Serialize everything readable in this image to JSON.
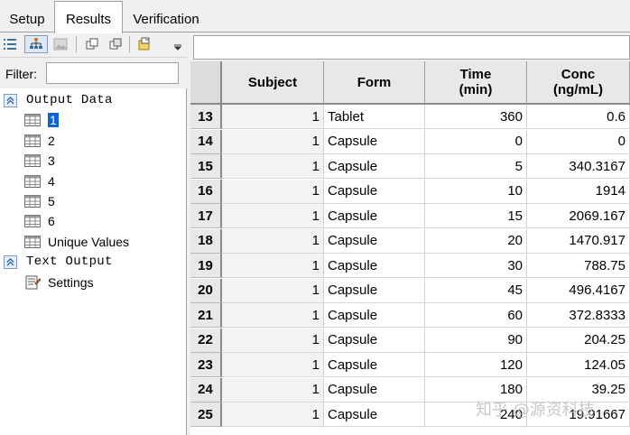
{
  "tabs": [
    {
      "label": "Setup",
      "active": false
    },
    {
      "label": "Results",
      "active": true
    },
    {
      "label": "Verification",
      "active": false
    }
  ],
  "toolbar": {
    "icons": [
      "list-view-icon",
      "tree-view-icon",
      "image-view-icon",
      "copy-icon",
      "copy-all-icon",
      "export-icon",
      "more-icon"
    ]
  },
  "filter": {
    "label": "Filter:",
    "value": ""
  },
  "tree": {
    "output_data": {
      "label": "Output Data",
      "items": [
        {
          "label": "1",
          "selected": true
        },
        {
          "label": "2",
          "selected": false
        },
        {
          "label": "3",
          "selected": false
        },
        {
          "label": "4",
          "selected": false
        },
        {
          "label": "5",
          "selected": false
        },
        {
          "label": "6",
          "selected": false
        },
        {
          "label": "Unique Values",
          "selected": false
        }
      ]
    },
    "text_output": {
      "label": "Text Output",
      "items": [
        {
          "label": "Settings"
        }
      ]
    }
  },
  "table": {
    "headers": [
      "Subject",
      "Form",
      "Time\n(min)",
      "Conc\n(ng/mL)"
    ],
    "rows": [
      {
        "n": "13",
        "subject": "1",
        "form": "Tablet",
        "time": "360",
        "conc": "0.6"
      },
      {
        "n": "14",
        "subject": "1",
        "form": "Capsule",
        "time": "0",
        "conc": "0"
      },
      {
        "n": "15",
        "subject": "1",
        "form": "Capsule",
        "time": "5",
        "conc": "340.3167"
      },
      {
        "n": "16",
        "subject": "1",
        "form": "Capsule",
        "time": "10",
        "conc": "1914"
      },
      {
        "n": "17",
        "subject": "1",
        "form": "Capsule",
        "time": "15",
        "conc": "2069.167"
      },
      {
        "n": "18",
        "subject": "1",
        "form": "Capsule",
        "time": "20",
        "conc": "1470.917"
      },
      {
        "n": "19",
        "subject": "1",
        "form": "Capsule",
        "time": "30",
        "conc": "788.75"
      },
      {
        "n": "20",
        "subject": "1",
        "form": "Capsule",
        "time": "45",
        "conc": "496.4167"
      },
      {
        "n": "21",
        "subject": "1",
        "form": "Capsule",
        "time": "60",
        "conc": "372.8333"
      },
      {
        "n": "22",
        "subject": "1",
        "form": "Capsule",
        "time": "90",
        "conc": "204.25"
      },
      {
        "n": "23",
        "subject": "1",
        "form": "Capsule",
        "time": "120",
        "conc": "124.05"
      },
      {
        "n": "24",
        "subject": "1",
        "form": "Capsule",
        "time": "180",
        "conc": "39.25"
      },
      {
        "n": "25",
        "subject": "1",
        "form": "Capsule",
        "time": "240",
        "conc": "19.91667"
      }
    ]
  },
  "watermark": "知乎 @源资科技",
  "colors": {
    "selection": "#0a64d8",
    "header_bg": "#e8e8e8",
    "panel_bg": "#f0f0f0"
  }
}
